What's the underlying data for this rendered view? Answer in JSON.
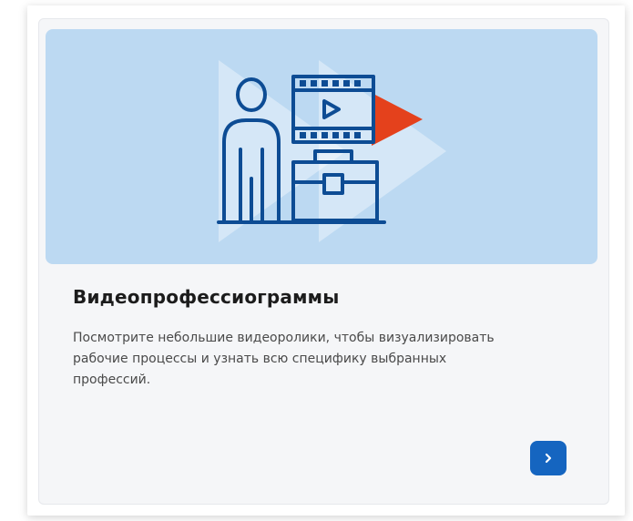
{
  "card": {
    "title": "Видеопрофессиограммы",
    "description": "Посмотрите небольшие видеоролики, чтобы визуализировать рабочие процессы и узнать всю специфику выбранных профессий.",
    "illustration_icon": "person-video-briefcase-icon",
    "next_icon": "chevron-right-icon"
  },
  "colors": {
    "hero_background": "#bcd9f2",
    "icon_stroke": "#0d4c94",
    "play_accent": "#e4411c",
    "button": "#1565c0"
  }
}
